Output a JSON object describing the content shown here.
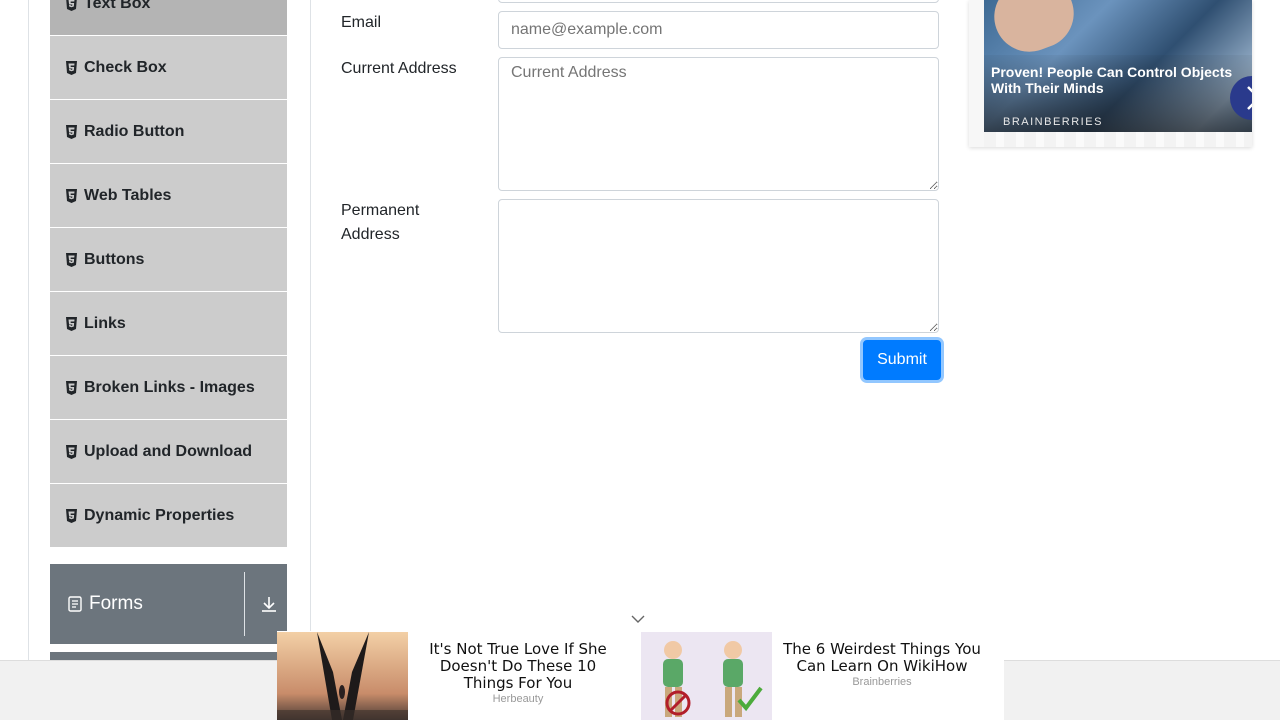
{
  "sidebar": {
    "items": [
      {
        "label": "Text Box",
        "active": true
      },
      {
        "label": "Check Box"
      },
      {
        "label": "Radio Button"
      },
      {
        "label": "Web Tables"
      },
      {
        "label": "Buttons"
      },
      {
        "label": "Links"
      },
      {
        "label": "Broken Links - Images"
      },
      {
        "label": "Upload and Download"
      },
      {
        "label": "Dynamic Properties"
      }
    ],
    "group": {
      "label": "Forms"
    }
  },
  "form": {
    "email": {
      "label": "Email",
      "placeholder": "name@example.com"
    },
    "current_address": {
      "label": "Current Address",
      "placeholder": "Current Address"
    },
    "permanent_address": {
      "label_line1": "Permanent",
      "label_line2": "Address"
    },
    "submit_label": "Submit"
  },
  "ad_right": {
    "title": "Proven! People Can Control Objects With Their Minds",
    "source": "BRAINBERRIES"
  },
  "bottom_ads": [
    {
      "title": "It's Not True Love If She Doesn't Do These 10 Things For You",
      "source": "Herbeauty"
    },
    {
      "title": "The 6 Weirdest Things You Can Learn On WikiHow",
      "source": "Brainberries"
    }
  ],
  "colors": {
    "accent": "#007bff",
    "menu_bg": "#cccccc",
    "group_bg": "#6c757d"
  }
}
